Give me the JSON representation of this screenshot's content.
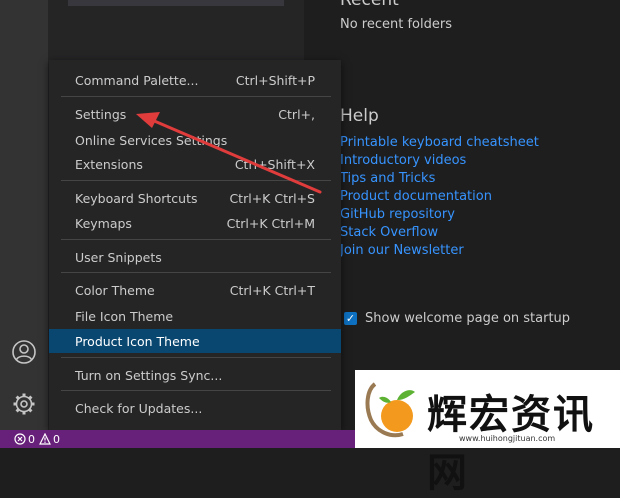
{
  "welcome": {
    "recent_title": "Recent",
    "recent_empty": "No recent folders",
    "help_title": "Help",
    "help_links": [
      "Printable keyboard cheatsheet",
      "Introductory videos",
      "Tips and Tricks",
      "Product documentation",
      "GitHub repository",
      "Stack Overflow",
      "Join our Newsletter"
    ],
    "startup_checkbox_label": "Show welcome page on startup",
    "startup_checked": true
  },
  "menu": {
    "items": [
      {
        "label": "Command Palette...",
        "shortcut": "Ctrl+Shift+P"
      },
      {
        "label": "Settings",
        "shortcut": "Ctrl+,"
      },
      {
        "label": "Online Services Settings",
        "shortcut": ""
      },
      {
        "label": "Extensions",
        "shortcut": "Ctrl+Shift+X"
      },
      {
        "label": "Keyboard Shortcuts",
        "shortcut": "Ctrl+K Ctrl+S"
      },
      {
        "label": "Keymaps",
        "shortcut": "Ctrl+K Ctrl+M"
      },
      {
        "label": "User Snippets",
        "shortcut": ""
      },
      {
        "label": "Color Theme",
        "shortcut": "Ctrl+K Ctrl+T"
      },
      {
        "label": "File Icon Theme",
        "shortcut": ""
      },
      {
        "label": "Product Icon Theme",
        "shortcut": ""
      },
      {
        "label": "Turn on Settings Sync...",
        "shortcut": ""
      },
      {
        "label": "Check for Updates...",
        "shortcut": ""
      }
    ],
    "active_item": "Product Icon Theme"
  },
  "status_bar": {
    "errors": "0",
    "warnings": "0"
  },
  "watermark": {
    "title": "辉宏资讯网",
    "url": "www.huihongjituan.com"
  },
  "icons": {
    "account": "account-icon",
    "manage": "gear-icon",
    "error": "error-icon",
    "warning": "warning-icon"
  },
  "colors": {
    "status_bar": "#68217a",
    "menu_highlight": "#094771",
    "link": "#3794ff",
    "annotation_arrow": "#e03c3c"
  }
}
